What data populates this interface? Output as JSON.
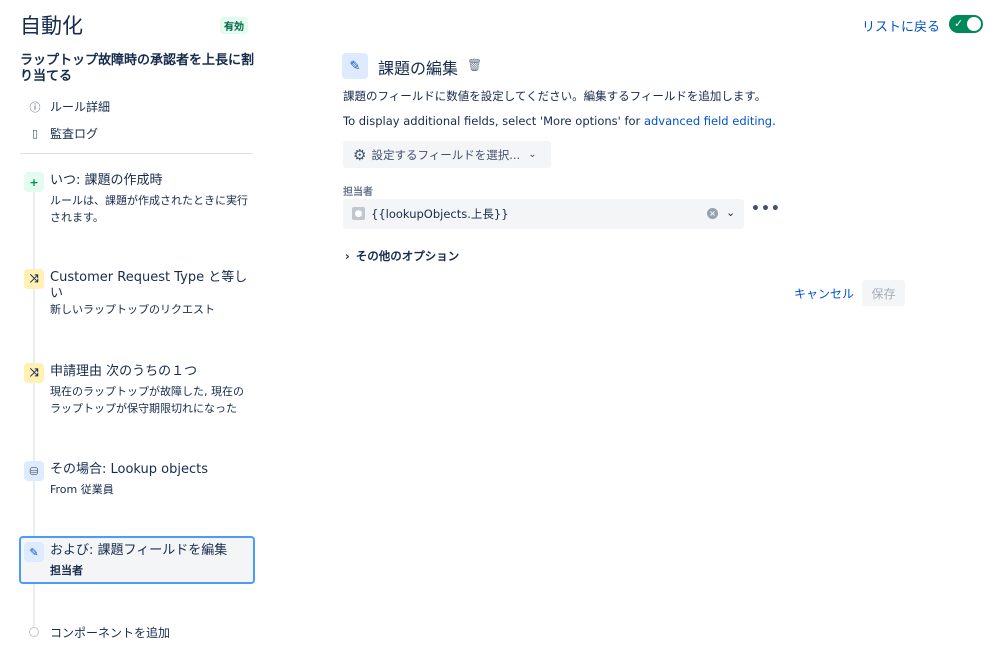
{
  "header": {
    "title": "自動化",
    "status": "有効",
    "back_link": "リストに戻る",
    "toggle_icon": "check-icon"
  },
  "sidebar": {
    "rule_name": "ラップトップ故障時の承認者を上長に割り当てる",
    "links": [
      {
        "icon": "info-icon",
        "label": "ルール詳細"
      },
      {
        "icon": "document-icon",
        "label": "監査ログ"
      }
    ],
    "steps": [
      {
        "type": "trigger",
        "icon": "plus-icon",
        "title": "いつ: 課題の作成時",
        "desc": "ルールは、課題が作成されたときに実行されます。"
      },
      {
        "type": "condition",
        "icon": "shuffle-icon",
        "title": "Customer Request Type と等しい",
        "desc": "新しいラップトップのリクエスト"
      },
      {
        "type": "condition",
        "icon": "shuffle-icon",
        "title": "申請理由 次のうちの１つ",
        "desc": "現在のラップトップが故障した, 現在のラップトップが保守期限切れになった"
      },
      {
        "type": "branch",
        "icon": "database-icon",
        "title": "その場合: Lookup objects",
        "desc": "From 従業員"
      },
      {
        "type": "action",
        "icon": "pencil-icon",
        "title": "および: 課題フィールドを編集",
        "desc": "担当者"
      }
    ],
    "add_component": "コンポーネントを追加"
  },
  "panel": {
    "title": "課題の編集",
    "description": "課題のフィールドに数値を設定してください。編集するフィールドを追加します。",
    "info_prefix": "To display additional fields, select 'More options' for ",
    "info_link": "advanced field editing",
    "info_suffix": ".",
    "field_select": "設定するフィールドを選択...",
    "assignee_label": "担当者",
    "assignee_value": "{{lookupObjects.上長}}",
    "more_options": "その他のオプション",
    "cancel": "キャンセル",
    "save": "保存"
  },
  "colors": {
    "primary": "#0052cc",
    "success": "#00875a",
    "active_border": "#4c9aff"
  }
}
